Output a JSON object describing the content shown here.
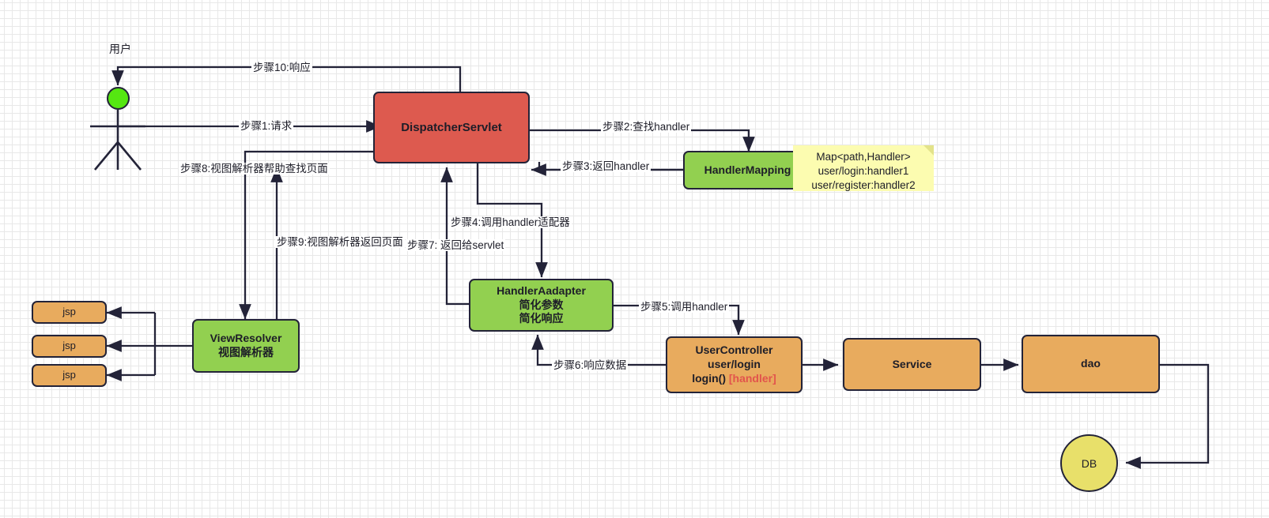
{
  "diagram": {
    "title_actor": "用户",
    "nodes": {
      "dispatcher": {
        "label": "DispatcherServlet",
        "color": "#dd5a4f"
      },
      "handler_mapping": {
        "label": "HandlerMapping",
        "color": "#92d050"
      },
      "handler_adapter": {
        "line1": "HandlerAadapter",
        "line2": "简化参数",
        "line3": "简化响应",
        "color": "#92d050"
      },
      "view_resolver": {
        "line1": "ViewResolver",
        "line2": "视图解析器",
        "color": "#92d050"
      },
      "user_controller": {
        "line1": "UserController",
        "line2": "user/login",
        "line3_method": "login()",
        "line3_tag": "[handler]",
        "color": "#e8ab5e",
        "tag_color": "#e2544c"
      },
      "service": {
        "label": "Service",
        "color": "#e8ab5e"
      },
      "dao": {
        "label": "dao",
        "color": "#e8ab5e"
      },
      "db": {
        "label": "DB",
        "color": "#e8e06a"
      },
      "jsp1": {
        "label": "jsp",
        "color": "#e8ab5e"
      },
      "jsp2": {
        "label": "jsp",
        "color": "#e8ab5e"
      },
      "jsp3": {
        "label": "jsp",
        "color": "#e8ab5e"
      }
    },
    "note": {
      "line1": "Map<path,Handler>",
      "line2": "user/login:handler1",
      "line3": "user/register:handler2",
      "color": "#fcfcb0"
    },
    "edges": {
      "step1": "步骤1:请求",
      "step2": "步骤2:查找handler",
      "step3": "步骤3:返回handler",
      "step4": "步骤4:调用handler适配器",
      "step5": "步骤5:调用handler",
      "step6": "步骤6:响应数据",
      "step7": "步骤7: 返回给servlet",
      "step8": "步骤8:视图解析器帮助查找页面",
      "step9": "步骤9:视图解析器返回页面",
      "step10": "步骤10:响应"
    }
  }
}
